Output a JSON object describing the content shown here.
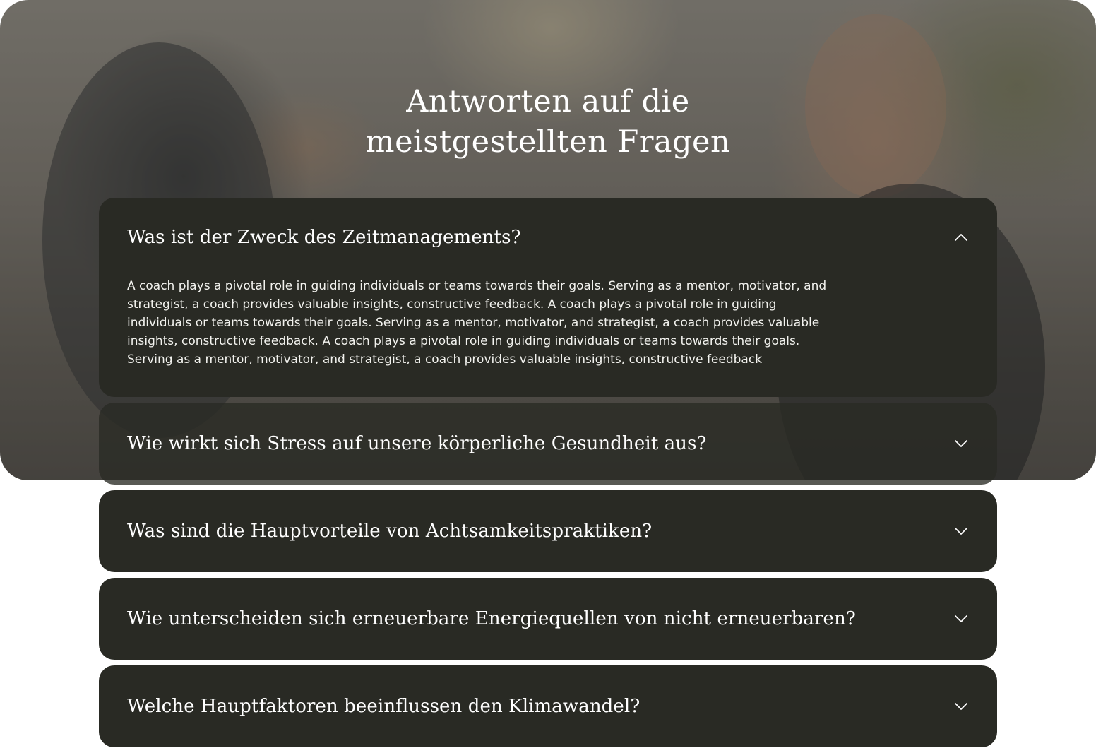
{
  "header": {
    "title_line1": "Antworten auf die",
    "title_line2": "meistgestellten Fragen"
  },
  "faq": {
    "items": [
      {
        "question": "Was ist der Zweck des Zeitmanagements?",
        "expanded": true,
        "answer": "A coach plays a pivotal role in guiding individuals or teams towards their goals. Serving as a mentor, motivator, and strategist, a coach provides valuable insights, constructive feedback. A coach plays a pivotal role in guiding individuals or teams towards their goals. Serving as a mentor, motivator, and strategist, a coach provides valuable insights, constructive feedback. A coach plays a pivotal role in guiding individuals or teams towards their goals. Serving as a mentor, motivator, and strategist, a coach provides valuable insights, constructive feedback"
      },
      {
        "question": "Wie wirkt sich Stress auf unsere körperliche Gesundheit aus?",
        "expanded": false
      },
      {
        "question": "Was sind die Hauptvorteile von Achtsamkeitspraktiken?",
        "expanded": false
      },
      {
        "question": "Wie unterscheiden sich erneuerbare Energiequellen von nicht erneuerbaren?",
        "expanded": false
      },
      {
        "question": "Welche Hauptfaktoren beeinflussen den Klimawandel?",
        "expanded": false
      }
    ]
  },
  "icons": {
    "expanded": "chevron-up-icon",
    "collapsed": "chevron-down-icon"
  },
  "colors": {
    "card_background": "#292a24",
    "text": "#ffffff"
  }
}
